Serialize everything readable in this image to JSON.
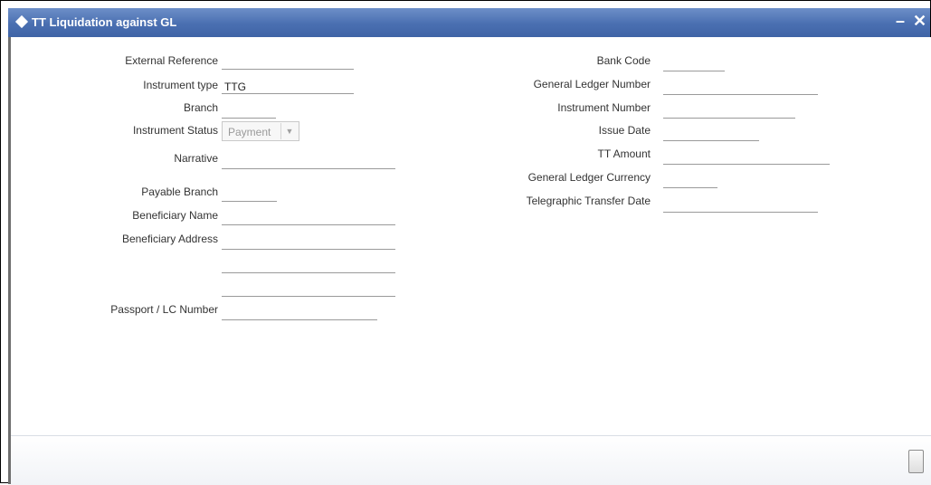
{
  "window": {
    "title": "TT Liquidation against GL",
    "minimize_symbol": "–",
    "close_symbol": "✕"
  },
  "form": {
    "external_reference": {
      "label": "External Reference",
      "value": ""
    },
    "instrument_type": {
      "label": "Instrument type",
      "value": "TTG"
    },
    "branch": {
      "label": "Branch",
      "value": ""
    },
    "instrument_status": {
      "label": "Instrument Status",
      "selected": "Payment"
    },
    "narrative": {
      "label": "Narrative",
      "value": ""
    },
    "payable_branch": {
      "label": "Payable Branch",
      "value": ""
    },
    "beneficiary_name": {
      "label": "Beneficiary Name",
      "value": ""
    },
    "beneficiary_address": {
      "label": "Beneficiary Address",
      "line1": "",
      "line2": "",
      "line3": ""
    },
    "passport_lc_number": {
      "label": "Passport / LC Number",
      "value": ""
    },
    "bank_code": {
      "label": "Bank Code",
      "value": ""
    },
    "general_ledger_number": {
      "label": "General Ledger Number",
      "value": ""
    },
    "instrument_number": {
      "label": "Instrument Number",
      "value": ""
    },
    "issue_date": {
      "label": "Issue Date",
      "value": ""
    },
    "tt_amount": {
      "label": "TT Amount",
      "value": ""
    },
    "general_ledger_currency": {
      "label": "General Ledger Currency",
      "value": ""
    },
    "telegraphic_transfer_date": {
      "label": "Telegraphic Transfer Date",
      "value": ""
    }
  },
  "icons": {
    "title": "diamond-icon",
    "minimize": "minimize-icon",
    "close": "close-icon",
    "arrow": "chevron-down-icon",
    "exit": "exit-icon"
  },
  "colors": {
    "titlebar": "#4a6fb1",
    "label_text": "#333333",
    "field_underline": "#9a9a9a"
  }
}
